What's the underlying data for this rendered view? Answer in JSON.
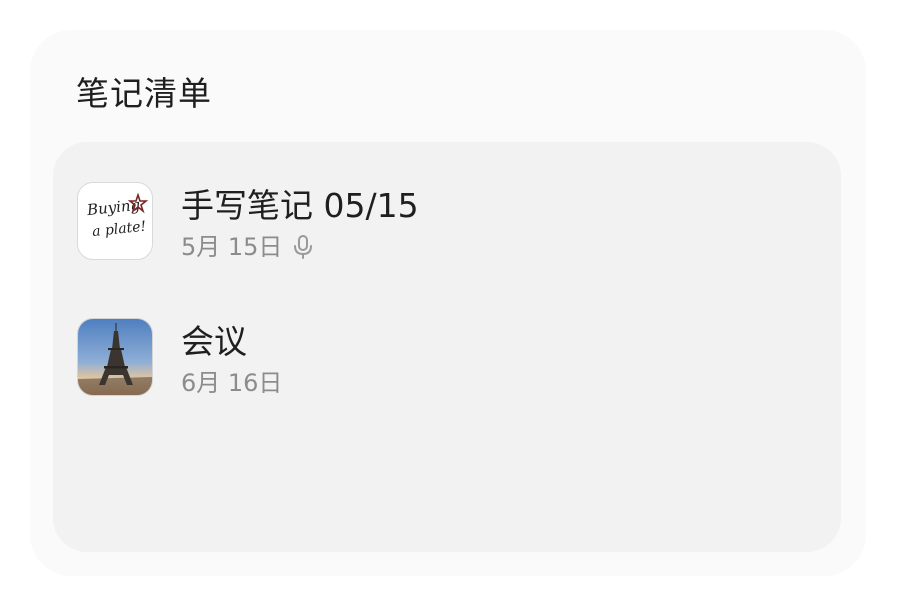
{
  "widget": {
    "title": "笔记清单"
  },
  "notes": [
    {
      "title": "手写笔记 05/15",
      "date": "5月 15日",
      "thumbnail_text_line1": "Buying",
      "thumbnail_text_line2": "a plate!",
      "has_audio": true,
      "thumbnail_icon": "handwriting-thumbnail",
      "meta_icon": "microphone-icon"
    },
    {
      "title": "会议",
      "date": "6月 16日",
      "has_audio": false,
      "thumbnail_icon": "eiffel-tower-thumbnail"
    }
  ],
  "colors": {
    "widget_bg": "#fafafa",
    "card_bg": "#f2f2f2",
    "title_text": "#1f1f1f",
    "meta_text": "#8c8c8c",
    "star_accent": "#7a2424"
  }
}
